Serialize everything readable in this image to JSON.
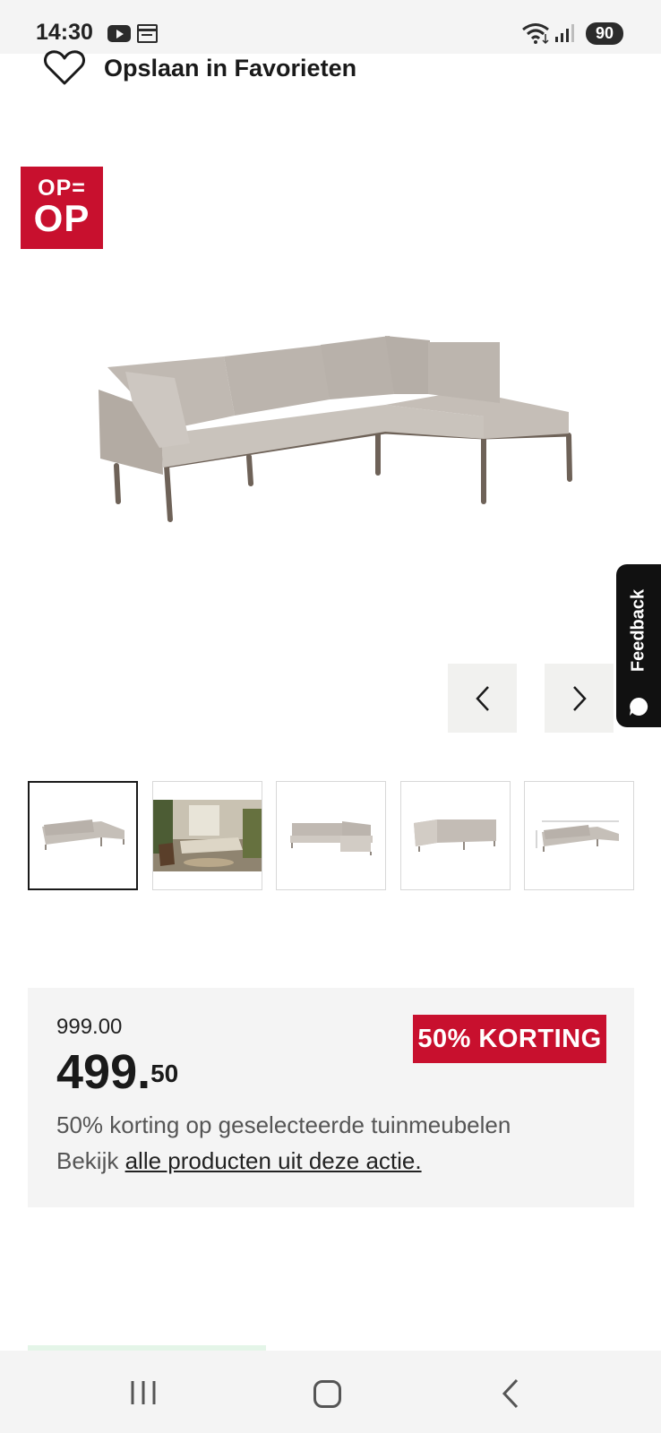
{
  "status_bar": {
    "time": "14:30",
    "icons": [
      "youtube-icon",
      "calendar-icon",
      "wifi-icon",
      "signal-icon"
    ],
    "battery": "90"
  },
  "favorites": {
    "icon": "heart-icon",
    "label": "Opslaan in Favorieten"
  },
  "badge": {
    "line1": "OP=",
    "line2": "OP",
    "color": "#c8102e"
  },
  "product_image": {
    "alt_subject": "sofa"
  },
  "carousel": {
    "prev_icon": "chevron-left-icon",
    "next_icon": "chevron-right-icon",
    "thumbnails": [
      {
        "name": "sofa-front",
        "active": true
      },
      {
        "name": "sofa-garden-scene",
        "active": false
      },
      {
        "name": "sofa-chaise",
        "active": false
      },
      {
        "name": "sofa-back",
        "active": false
      },
      {
        "name": "sofa-dimensions",
        "active": false
      }
    ]
  },
  "feedback": {
    "label": "Feedback",
    "icon": "chat-bubble-icon"
  },
  "price": {
    "old": "999.00",
    "main": "499.",
    "cents": "50",
    "discount_label": "50% KORTING",
    "promo_text": "50% korting op geselecteerde tuinmeubelen",
    "promo_prefix": "Bekijk",
    "promo_link": "alle producten uit deze actie.",
    "accent_color": "#c8102e"
  },
  "nav_bar": {
    "icons": [
      "recents-icon",
      "home-icon",
      "back-icon"
    ]
  }
}
